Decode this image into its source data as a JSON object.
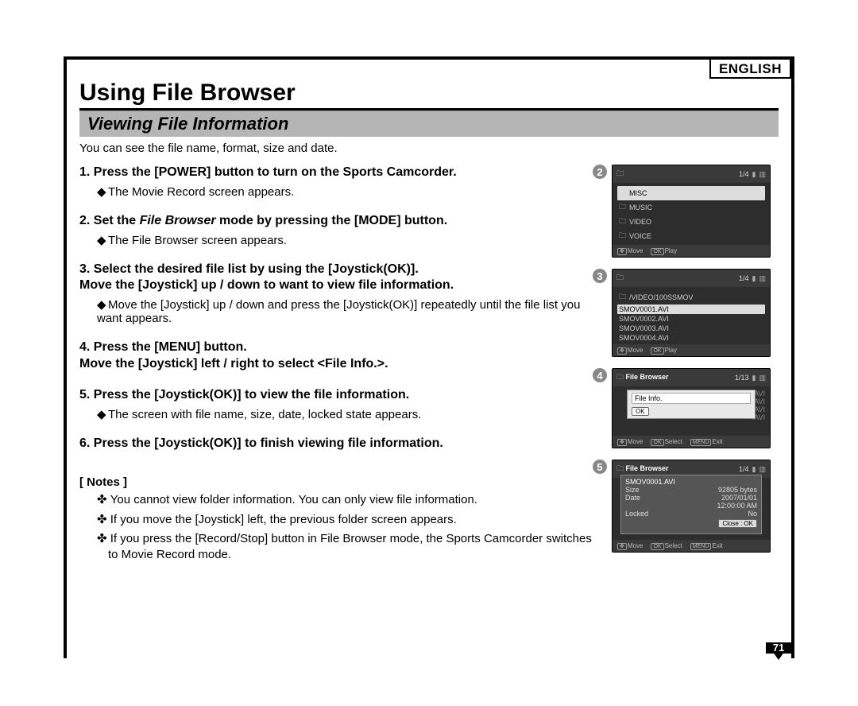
{
  "language": "ENGLISH",
  "title": "Using File Browser",
  "subtitle": "Viewing File Information",
  "intro": "You can see the file name, format, size and date.",
  "steps": {
    "s1": {
      "head": "1. Press the [POWER] button to turn on the Sports Camcorder.",
      "sub": "The Movie Record screen appears."
    },
    "s2": {
      "head_a": "2. Set the ",
      "head_fb": "File Browser",
      "head_b": " mode by pressing the [MODE] button.",
      "sub": "The File Browser screen appears."
    },
    "s3": {
      "line1": "3. Select the desired file list by using the [Joystick(OK)].",
      "line2": "Move the [Joystick] up / down to want to view file information.",
      "sub": "Move the [Joystick] up / down and press the [Joystick(OK)] repeatedly until the file list you want appears."
    },
    "s4": {
      "line1": "4. Press the [MENU] button.",
      "line2": "Move the [Joystick] left / right to select <File Info.>."
    },
    "s5": {
      "line1": "5. Press the [Joystick(OK)] to view the file information.",
      "sub": "The screen with file name, size, date, locked state appears."
    },
    "s6": {
      "line1": "6. Press the [Joystick(OK)] to finish viewing file information."
    }
  },
  "notes_title": "[ Notes ]",
  "notes": [
    "You cannot view folder information. You can only view file information.",
    "If you move the [Joystick] left, the previous folder screen appears.",
    "If you press the [Record/Stop] button in File Browser mode, the Sports Camcorder switches to Movie Record mode."
  ],
  "diamond": "◆",
  "flower": "✤",
  "screens": {
    "s2": {
      "num": "2",
      "page": "1/4",
      "items": [
        "MISC",
        "MUSIC",
        "VIDEO",
        "VOICE"
      ],
      "foot_move": "Move",
      "foot_play": "Play",
      "k_move": "✥",
      "k_ok": "OK"
    },
    "s3": {
      "num": "3",
      "page": "1/4",
      "path": "/VIDEO/100SSMOV",
      "items": [
        "SMOV0001.AVI",
        "SMOV0002.AVI",
        "SMOV0003.AVI",
        "SMOV0004.AVI"
      ],
      "foot_move": "Move",
      "foot_play": "Play",
      "k_move": "✥",
      "k_ok": "OK"
    },
    "s4": {
      "num": "4",
      "title": "File Browser",
      "page": "1/13",
      "menu": "File Info.",
      "ok": "OK",
      "dimrows": [
        ".AVI",
        ".AVI",
        ".AVI",
        ".AVI"
      ],
      "foot_move": "Move",
      "foot_select": "Select",
      "foot_exit": "Exit",
      "k_move": "✥",
      "k_ok": "OK",
      "k_menu": "MENU"
    },
    "s5": {
      "num": "5",
      "title": "File Browser",
      "page": "1/4",
      "file": "SMOV0001.AVI",
      "size_l": "Size",
      "size_v": "92805 bytes",
      "date_l": "Date",
      "date_v": "2007/01/01",
      "time_v": "12:00:00 AM",
      "lock_l": "Locked",
      "lock_v": "No",
      "close": "Close : OK",
      "foot_move": "Move",
      "foot_select": "Select",
      "foot_exit": "Exit",
      "k_move": "✥",
      "k_ok": "OK",
      "k_menu": "MENU"
    }
  },
  "page_number": "71"
}
